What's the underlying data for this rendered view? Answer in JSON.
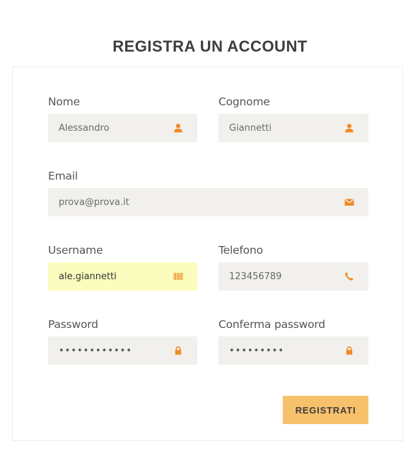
{
  "page": {
    "title": "REGISTRA UN ACCOUNT"
  },
  "form": {
    "nome": {
      "label": "Nome",
      "value": "Alessandro",
      "icon": "user-icon"
    },
    "cognome": {
      "label": "Cognome",
      "value": "Giannetti",
      "icon": "user-icon"
    },
    "email": {
      "label": "Email",
      "value": "prova@prova.it",
      "icon": "envelope-icon"
    },
    "username": {
      "label": "Username",
      "value": "ale.giannetti",
      "icon": "barcode-icon"
    },
    "telefono": {
      "label": "Telefono",
      "value": "123456789",
      "icon": "phone-icon"
    },
    "password": {
      "label": "Password",
      "value": "••••••••••••",
      "icon": "lock-icon"
    },
    "conferma": {
      "label": "Conferma password",
      "value": "•••••••••",
      "icon": "lock-icon"
    },
    "submit_label": "REGISTRATI"
  },
  "colors": {
    "accent_icon": "#f08a24",
    "button_bg": "#f7c16b",
    "input_bg": "#f1f0ec",
    "autofill_bg": "#fafdbd"
  }
}
